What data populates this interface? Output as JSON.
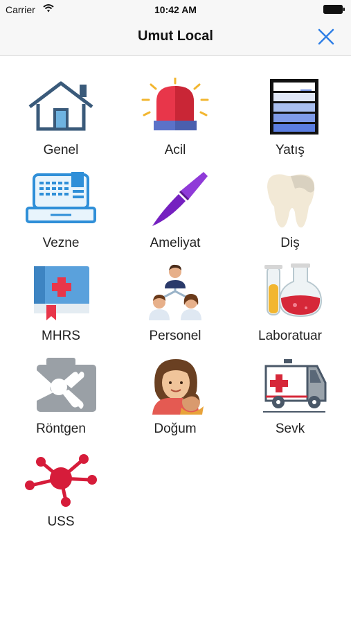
{
  "status": {
    "carrier": "Carrier",
    "time": "10:42 AM"
  },
  "nav": {
    "title": "Umut Local",
    "close_icon": "close-icon",
    "accent": "#2f7fe6"
  },
  "menu": [
    {
      "label": "Genel",
      "icon": "house-icon"
    },
    {
      "label": "Acil",
      "icon": "siren-icon"
    },
    {
      "label": "Yatış",
      "icon": "ward-shelf-icon"
    },
    {
      "label": "Vezne",
      "icon": "cash-register-icon"
    },
    {
      "label": "Ameliyat",
      "icon": "scalpel-icon"
    },
    {
      "label": "Diş",
      "icon": "tooth-icon"
    },
    {
      "label": "MHRS",
      "icon": "medical-book-icon"
    },
    {
      "label": "Personel",
      "icon": "staff-icon"
    },
    {
      "label": "Laboratuar",
      "icon": "lab-flask-icon"
    },
    {
      "label": "Röntgen",
      "icon": "xray-icon"
    },
    {
      "label": "Doğum",
      "icon": "mother-baby-icon"
    },
    {
      "label": "Sevk",
      "icon": "ambulance-icon"
    },
    {
      "label": "USS",
      "icon": "network-icon"
    }
  ]
}
